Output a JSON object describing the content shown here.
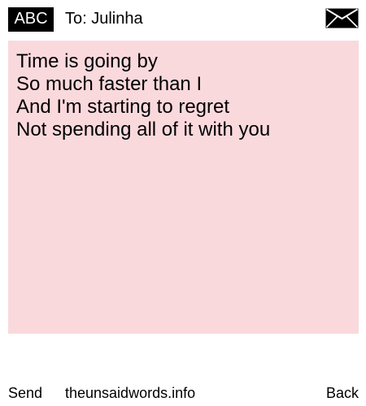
{
  "header": {
    "mode": "ABC",
    "recipient": "To: Julinha",
    "icon": "envelope-icon"
  },
  "message": {
    "lines": [
      "Time is going by",
      "So much faster than I",
      "And I'm starting to regret",
      "Not spending all of it with you"
    ]
  },
  "footer": {
    "send_label": "Send",
    "site_label": "theunsaidwords.info",
    "back_label": "Back"
  },
  "colors": {
    "background": "#ffffff",
    "message_background": "#fad9dd",
    "badge_background": "#000000",
    "badge_text": "#ffffff",
    "text": "#000000"
  }
}
